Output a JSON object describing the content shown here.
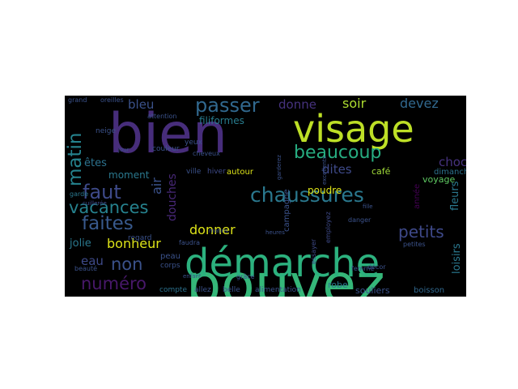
{
  "word_cloud": {
    "background": "#000000",
    "words": [
      {
        "text": "pouvez",
        "color": "#35b779"
      },
      {
        "text": "bien",
        "color": "#472d7b"
      },
      {
        "text": "visage",
        "color": "#bddf26"
      },
      {
        "text": "démarche",
        "color": "#2cb17e"
      },
      {
        "text": "chaussures",
        "color": "#2a788e"
      },
      {
        "text": "beaucoup",
        "color": "#27ad81"
      },
      {
        "text": "faites",
        "color": "#38598c"
      },
      {
        "text": "faut",
        "color": "#3e4a89"
      },
      {
        "text": "vacances",
        "color": "#26828e"
      },
      {
        "text": "matin",
        "color": "#25838e"
      },
      {
        "text": "passer",
        "color": "#31688e"
      },
      {
        "text": "numéro",
        "color": "#48186a"
      },
      {
        "text": "non",
        "color": "#3b528b"
      },
      {
        "text": "petits",
        "color": "#3e4989"
      },
      {
        "text": "bonheur",
        "color": "#dde318"
      },
      {
        "text": "donner",
        "color": "#dde318"
      },
      {
        "text": "soir",
        "color": "#addc30"
      },
      {
        "text": "devez",
        "color": "#31688e"
      },
      {
        "text": "dites",
        "color": "#3e4a89"
      },
      {
        "text": "choc",
        "color": "#46327e"
      },
      {
        "text": "donne",
        "color": "#46327e"
      },
      {
        "text": "bleu",
        "color": "#3b528b"
      },
      {
        "text": "air",
        "color": "#3b528b"
      },
      {
        "text": "douches",
        "color": "#482878"
      },
      {
        "text": "eau",
        "color": "#3e4a89"
      },
      {
        "text": "jolie",
        "color": "#2a788e"
      },
      {
        "text": "êtes",
        "color": "#2c728e"
      },
      {
        "text": "moment",
        "color": "#2a788e"
      },
      {
        "text": "filiformes",
        "color": "#287c8e"
      },
      {
        "text": "loisirs",
        "color": "#2a788e"
      },
      {
        "text": "fleurs",
        "color": "#2a788e"
      },
      {
        "text": "poudre",
        "color": "#dde318"
      },
      {
        "text": "café",
        "color": "#a0da39"
      },
      {
        "text": "voyage",
        "color": "#5ec962"
      },
      {
        "text": "dimanche",
        "color": "#2c728e"
      },
      {
        "text": "année",
        "color": "#440154"
      },
      {
        "text": "robe",
        "color": "#2a788e"
      },
      {
        "text": "souliers",
        "color": "#3b528b"
      },
      {
        "text": "boisson",
        "color": "#31688e"
      },
      {
        "text": "alimentation",
        "color": "#3b528b"
      },
      {
        "text": "belle",
        "color": "#3b528b"
      },
      {
        "text": "allez",
        "color": "#3b528b"
      },
      {
        "text": "compte",
        "color": "#2c728e"
      },
      {
        "text": "peau",
        "color": "#3b528b"
      },
      {
        "text": "corps",
        "color": "#3b528b"
      },
      {
        "text": "regard",
        "color": "#3b528b"
      },
      {
        "text": "ville",
        "color": "#3b528b"
      },
      {
        "text": "hiver",
        "color": "#3e4a89"
      },
      {
        "text": "autour",
        "color": "#dde318"
      },
      {
        "text": "campagne",
        "color": "#3b528b"
      },
      {
        "text": "yeux",
        "color": "#3b528b"
      },
      {
        "text": "cheveux",
        "color": "#3b528b"
      },
      {
        "text": "couleur",
        "color": "#3b528b"
      },
      {
        "text": "attention",
        "color": "#3b528b"
      },
      {
        "text": "neige",
        "color": "#3b528b"
      },
      {
        "text": "grand",
        "color": "#3b528b"
      },
      {
        "text": "oreilles",
        "color": "#3b528b"
      },
      {
        "text": "garde",
        "color": "#2a788e"
      },
      {
        "text": "cuillerée",
        "color": "#3e4a89"
      },
      {
        "text": "faudra",
        "color": "#3b528b"
      },
      {
        "text": "enfant",
        "color": "#3b528b"
      },
      {
        "text": "beauté",
        "color": "#3b528b"
      },
      {
        "text": "femme",
        "color": "#3b528b"
      },
      {
        "text": "danger",
        "color": "#3b528b"
      },
      {
        "text": "décor",
        "color": "#3b528b"
      },
      {
        "text": "petites",
        "color": "#3b528b"
      },
      {
        "text": "employez",
        "color": "#3e4a89"
      },
      {
        "text": "essayer",
        "color": "#3e4a89"
      },
      {
        "text": "heures",
        "color": "#3b528b"
      },
      {
        "text": "grâce",
        "color": "#3b528b"
      },
      {
        "text": "excellents",
        "color": "#3b528b"
      },
      {
        "text": "garderez",
        "color": "#3b528b"
      },
      {
        "text": "fille",
        "color": "#3b528b"
      },
      {
        "text": "jour",
        "color": "#3b528b"
      },
      {
        "text": "matins",
        "color": "#3b528b"
      }
    ]
  }
}
